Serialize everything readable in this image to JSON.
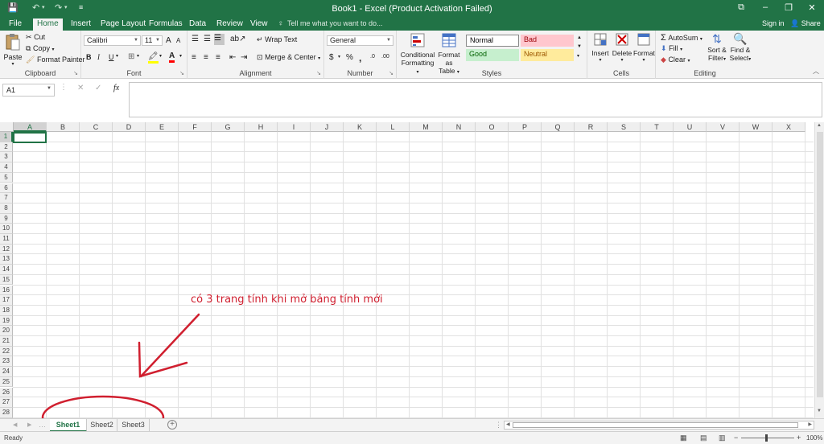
{
  "window": {
    "title": "Book1 - Excel (Product Activation Failed)",
    "buttons": {
      "restore_ribbon": "⧉",
      "minimize": "–",
      "maximize": "❐",
      "close": "✕"
    }
  },
  "qat": {
    "save": "💾",
    "undo": "↶",
    "undo_menu": "▾",
    "redo": "↷",
    "redo_menu": "▾",
    "customize": "≡"
  },
  "ribbon_tabs": [
    "File",
    "Home",
    "Insert",
    "Page Layout",
    "Formulas",
    "Data",
    "Review",
    "View"
  ],
  "tell_me": "Tell me what you want to do...",
  "account": {
    "signin": "Sign in",
    "share": "Share"
  },
  "groups": {
    "clipboard": {
      "label": "Clipboard",
      "paste": "Paste",
      "cut": "Cut",
      "copy": "Copy",
      "format_painter": "Format Painter"
    },
    "font": {
      "label": "Font",
      "name": "Calibri",
      "size": "11",
      "grow": "A",
      "shrink": "A",
      "bold": "B",
      "italic": "I",
      "underline": "U",
      "font_color": "A"
    },
    "alignment": {
      "label": "Alignment",
      "wrap_text": "Wrap Text",
      "merge_center": "Merge & Center"
    },
    "number": {
      "label": "Number",
      "format": "General",
      "currency": "$",
      "percent": "%",
      "comma": ",",
      "inc_dec": ".0",
      "dec_dec": ".00"
    },
    "styles": {
      "label": "Styles",
      "conditional": "Conditional",
      "conditional2": "Formatting",
      "format_as": "Format as",
      "format_as2": "Table",
      "cells": [
        {
          "name": "Normal",
          "bg": "#ffffff",
          "fg": "#000000"
        },
        {
          "name": "Bad",
          "bg": "#ffc7ce",
          "fg": "#9c0006"
        },
        {
          "name": "Good",
          "bg": "#c6efce",
          "fg": "#006100"
        },
        {
          "name": "Neutral",
          "bg": "#ffeb9c",
          "fg": "#9c5700"
        }
      ]
    },
    "cells": {
      "label": "Cells",
      "insert": "Insert",
      "delete": "Delete",
      "format": "Format"
    },
    "editing": {
      "label": "Editing",
      "autosum": "AutoSum",
      "fill": "Fill",
      "clear": "Clear",
      "sort": "Sort &",
      "sort2": "Filter",
      "find": "Find &",
      "find2": "Select"
    }
  },
  "formula_bar": {
    "name_box": "A1",
    "cancel": "✕",
    "enter": "✓",
    "fx": "fx",
    "value": ""
  },
  "columns": [
    "A",
    "B",
    "C",
    "D",
    "E",
    "F",
    "G",
    "H",
    "I",
    "J",
    "K",
    "L",
    "M",
    "N",
    "O",
    "P",
    "Q",
    "R",
    "S",
    "T",
    "U",
    "V",
    "W",
    "X"
  ],
  "rows": [
    "1",
    "2",
    "3",
    "4",
    "5",
    "6",
    "7",
    "8",
    "9",
    "10",
    "11",
    "12",
    "13",
    "14",
    "15",
    "16",
    "17",
    "18",
    "19",
    "20",
    "21",
    "22",
    "23",
    "24",
    "25",
    "26",
    "27",
    "28"
  ],
  "sheets": [
    "Sheet1",
    "Sheet2",
    "Sheet3"
  ],
  "active_sheet": "Sheet1",
  "add_sheet": "+",
  "status": {
    "ready": "Ready",
    "zoom": "100%",
    "zoom_minus": "−",
    "zoom_plus": "+"
  },
  "annotation": {
    "text": "có 3 trang tính khi mở bảng tính mới",
    "color": "#d01f2f"
  },
  "colors": {
    "accent": "#217346",
    "ribbon_bg": "#f3f3f3"
  }
}
